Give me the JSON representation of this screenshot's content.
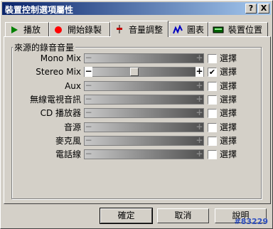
{
  "window": {
    "title": "裝置控制選項屬性"
  },
  "titlebar_buttons": {
    "help": "?",
    "close": "X"
  },
  "tabs": [
    {
      "label": "播放",
      "icon": "play-icon",
      "color": "#008000"
    },
    {
      "label": "開始錄製",
      "icon": "record-icon",
      "color": "#ff0000"
    },
    {
      "label": "音量調整",
      "icon": "mixer-icon",
      "color": "#c00000",
      "active": true
    },
    {
      "label": "圖表",
      "icon": "graph-icon",
      "color": "#0000c0"
    },
    {
      "label": "裝置位置",
      "icon": "device-icon",
      "color": "#006000"
    }
  ],
  "group": {
    "title": "來源的錄音音量"
  },
  "sources": [
    {
      "label": "Mono Mix",
      "checkbox_label": "選擇",
      "checked": false,
      "enabled": false,
      "level": null
    },
    {
      "label": "Stereo Mix",
      "checkbox_label": "選擇",
      "checked": true,
      "enabled": true,
      "level": 0.4
    },
    {
      "label": "Aux",
      "checkbox_label": "選擇",
      "checked": false,
      "enabled": false,
      "level": null
    },
    {
      "label": "無線電視音訊",
      "checkbox_label": "選擇",
      "checked": false,
      "enabled": false,
      "level": null
    },
    {
      "label": "CD 播放器",
      "checkbox_label": "選擇",
      "checked": false,
      "enabled": false,
      "level": null
    },
    {
      "label": "音源",
      "checkbox_label": "選擇",
      "checked": false,
      "enabled": false,
      "level": null
    },
    {
      "label": "麥克風",
      "checkbox_label": "選擇",
      "checked": false,
      "enabled": false,
      "level": null
    },
    {
      "label": "電話線",
      "checkbox_label": "選擇",
      "checked": false,
      "enabled": false,
      "level": null
    }
  ],
  "buttons": {
    "ok": "確定",
    "cancel": "取消",
    "help": "說明"
  },
  "watermark": "#83229"
}
